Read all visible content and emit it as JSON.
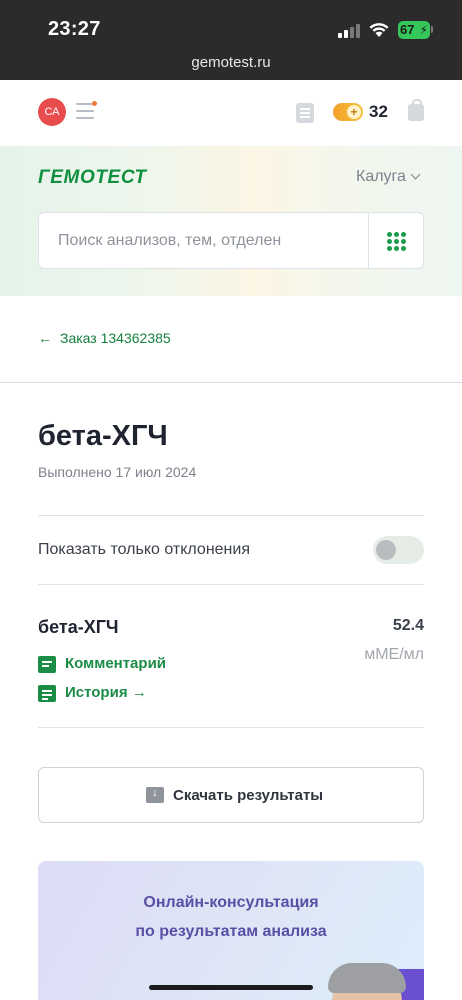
{
  "status_bar": {
    "time": "23:27",
    "battery": "67",
    "url": "gemotest.ru"
  },
  "header": {
    "avatar_initials": "СА",
    "bonus_count": "32"
  },
  "brand": {
    "logo": "ГЕМОТЕСТ",
    "city": "Калуга"
  },
  "search": {
    "placeholder": "Поиск анализов, тем, отделен",
    "value": ""
  },
  "nav": {
    "back_label": "Заказ 134362385"
  },
  "result": {
    "title": "бета-ХГЧ",
    "completed": "Выполнено 17 июл 2024",
    "toggle_label": "Показать только отклонения",
    "toggle_on": false,
    "analyte": {
      "name": "бета-ХГЧ",
      "value": "52.4",
      "unit": "мМЕ/мл"
    },
    "comment_label": "Комментарий",
    "history_label": "История →",
    "download_label": "Скачать результаты"
  },
  "promo": {
    "line1": "Онлайн-консультация",
    "line2": "по результатам анализа"
  },
  "colors": {
    "brand_green": "#0f8f3f",
    "link_green": "#1a8c46",
    "promo_text": "#5950a6",
    "avatar": "#e84c4c"
  }
}
